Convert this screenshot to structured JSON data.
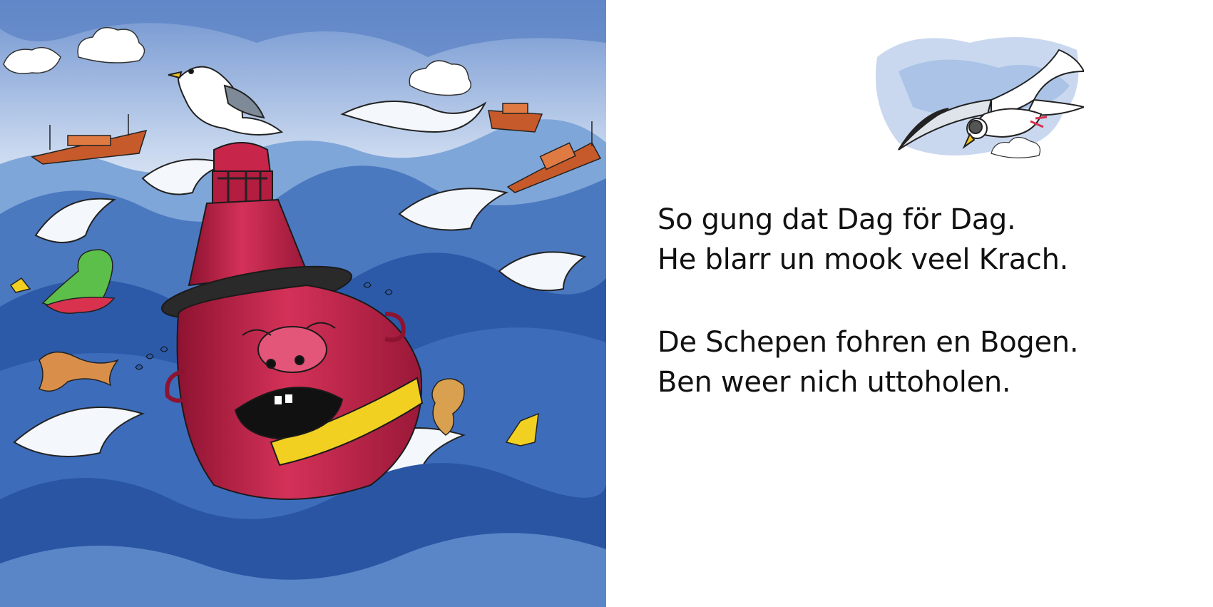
{
  "page": {
    "stanzas": [
      {
        "lines": [
          "So gung dat Dag för Dag.",
          "He blarr un mook veel Krach."
        ]
      },
      {
        "lines": [
          "De Schepen fohren en Bogen.",
          "Ben weer nich uttoholen."
        ]
      }
    ]
  },
  "illustration": {
    "main_scene": "crying-red-buoy-in-stormy-sea",
    "vignette": "flying-seagull-icon"
  },
  "colors": {
    "sea_dark": "#2c5aa8",
    "sea_light": "#7fa6d8",
    "buoy_red": "#c8254a",
    "band_yellow": "#f2d022",
    "ship_orange": "#c75a2a"
  }
}
